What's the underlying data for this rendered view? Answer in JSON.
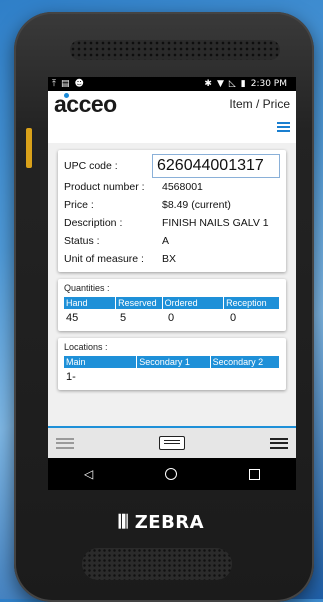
{
  "status": {
    "time": "2:30 PM",
    "left_icons": [
      "upload-icon",
      "sim-icon",
      "android-debug-icon"
    ],
    "right_icons": [
      "bluetooth-icon",
      "wifi-icon",
      "signal-icon",
      "battery-icon"
    ]
  },
  "app": {
    "brand": "acceo",
    "page_title": "Item / Price"
  },
  "item": {
    "upc_label": "UPC code :",
    "upc_value": "626044001317",
    "rows": [
      {
        "label": "Product number :",
        "value": "4568001"
      },
      {
        "label": "Price :",
        "value": "$8.49 (current)"
      },
      {
        "label": "Description :",
        "value": "FINISH NAILS GALV 1"
      },
      {
        "label": "Status :",
        "value": "A"
      },
      {
        "label": "Unit of measure :",
        "value": "BX"
      }
    ]
  },
  "quantities": {
    "title": "Quantities :",
    "headers": [
      "Hand",
      "Reserved",
      "Ordered",
      "Reception"
    ],
    "values": [
      "45",
      "5",
      "0",
      "0"
    ]
  },
  "locations": {
    "title": "Locations :",
    "headers": [
      "Main",
      "Secondary 1",
      "Secondary 2"
    ],
    "values": [
      "1-",
      "",
      ""
    ]
  },
  "device_brand": "ZEBRA",
  "colors": {
    "accent": "#1e90d8"
  }
}
